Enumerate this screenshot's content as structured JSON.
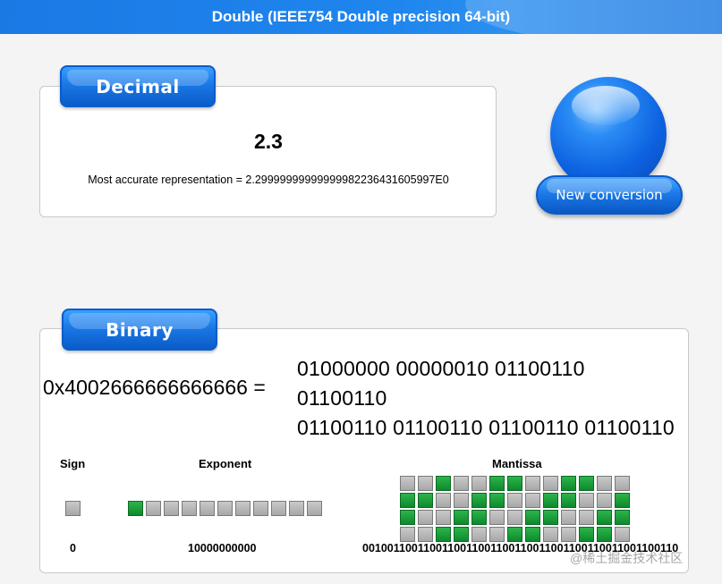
{
  "header": {
    "title": "Double (IEEE754 Double precision 64-bit)"
  },
  "decimal": {
    "tab_label": "Decimal",
    "value": "2.3",
    "accurate_text": "Most accurate representation = 2.29999999999999982236431605997E0"
  },
  "new_conversion": {
    "label": "New conversion"
  },
  "binary": {
    "tab_label": "Binary",
    "hex_value": "0x4002666666666666 =",
    "binary_lines": [
      "01000000 00000010 01100110",
      "01100110",
      "01100110 01100110 01100110 01100110"
    ],
    "sign": {
      "label": "Sign",
      "value": "0",
      "bits": "0"
    },
    "exponent": {
      "label": "Exponent",
      "value": "10000000000",
      "bits": "10000000000"
    },
    "mantissa": {
      "label": "Mantissa",
      "value": "0010011001100110011001100110011001100110011001100110",
      "bits": "0010011001100110011001100110011001100110011001100110"
    }
  },
  "colors": {
    "bit_on": "#16a23a",
    "bit_off": "#b8b8b8",
    "accent": "#1a78e6"
  },
  "watermark": "@稀土掘金技术社区"
}
